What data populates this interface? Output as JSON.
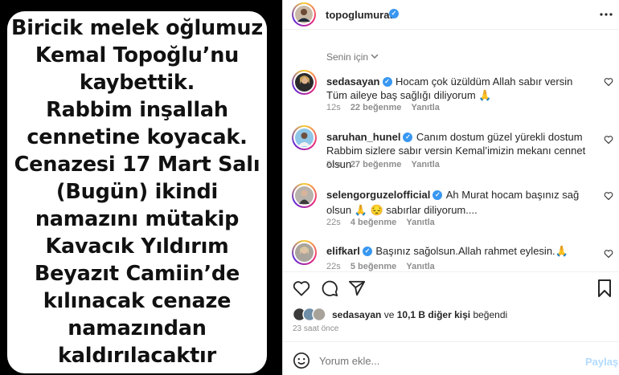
{
  "story": {
    "text": "Biricik melek oğlumuz\nKemal Topoğlu’nu\nkaybettik.\nRabbim inşallah\ncennetine koyacak.\nCenazesi 17 Mart Salı\n(Bugün) ikindi\nnamazını mütakip\nKavacık Yıldırım\nBeyazıt Camiin’de\nkılınacak cenaze\nnamazından\nkaldırılacaktır"
  },
  "header": {
    "username": "topoglumurat",
    "more_icon": "more-horizontal-icon"
  },
  "filter": {
    "label": "Senin için"
  },
  "comments": [
    {
      "username": "sedasayan",
      "text": "Hocam çok üzüldüm Allah sabır versin Tüm aileye baş sağlığı diliyorum 🙏",
      "time": "12s",
      "likes": "22 beğenme",
      "reply": "Yanıtla"
    },
    {
      "username": "saruhan_hunel",
      "text": "Canım dostum güzel yürekli dostum Rabbim sizlere sabır versin Kemal’imizin mekanı cennet olsun",
      "time": "21s",
      "likes": "27 beğenme",
      "reply": "Yanıtla"
    },
    {
      "username": "selengorguzelofficial",
      "text": "Ah Murat hocam başınız sağ olsun 🙏 😔 sabırlar diliyorum....",
      "time": "22s",
      "likes": "4 beğenme",
      "reply": "Yanıtla"
    },
    {
      "username": "elifkarl",
      "text": "Başınız sağolsun.Allah rahmet eylesin.🙏",
      "time": "22s",
      "likes": "5 beğenme",
      "reply": "Yanıtla"
    }
  ],
  "likes_line": {
    "user": "sedasayan",
    "middle": " ve ",
    "others": "10,1 B diğer kişi",
    "end": " beğendi"
  },
  "posted": "23 saat önce",
  "composer": {
    "placeholder": "Yorum ekle...",
    "share": "Paylaş"
  },
  "colors": {
    "verified": "#3897f0",
    "share": "#b3dbff",
    "meta": "#8e8e8e"
  }
}
